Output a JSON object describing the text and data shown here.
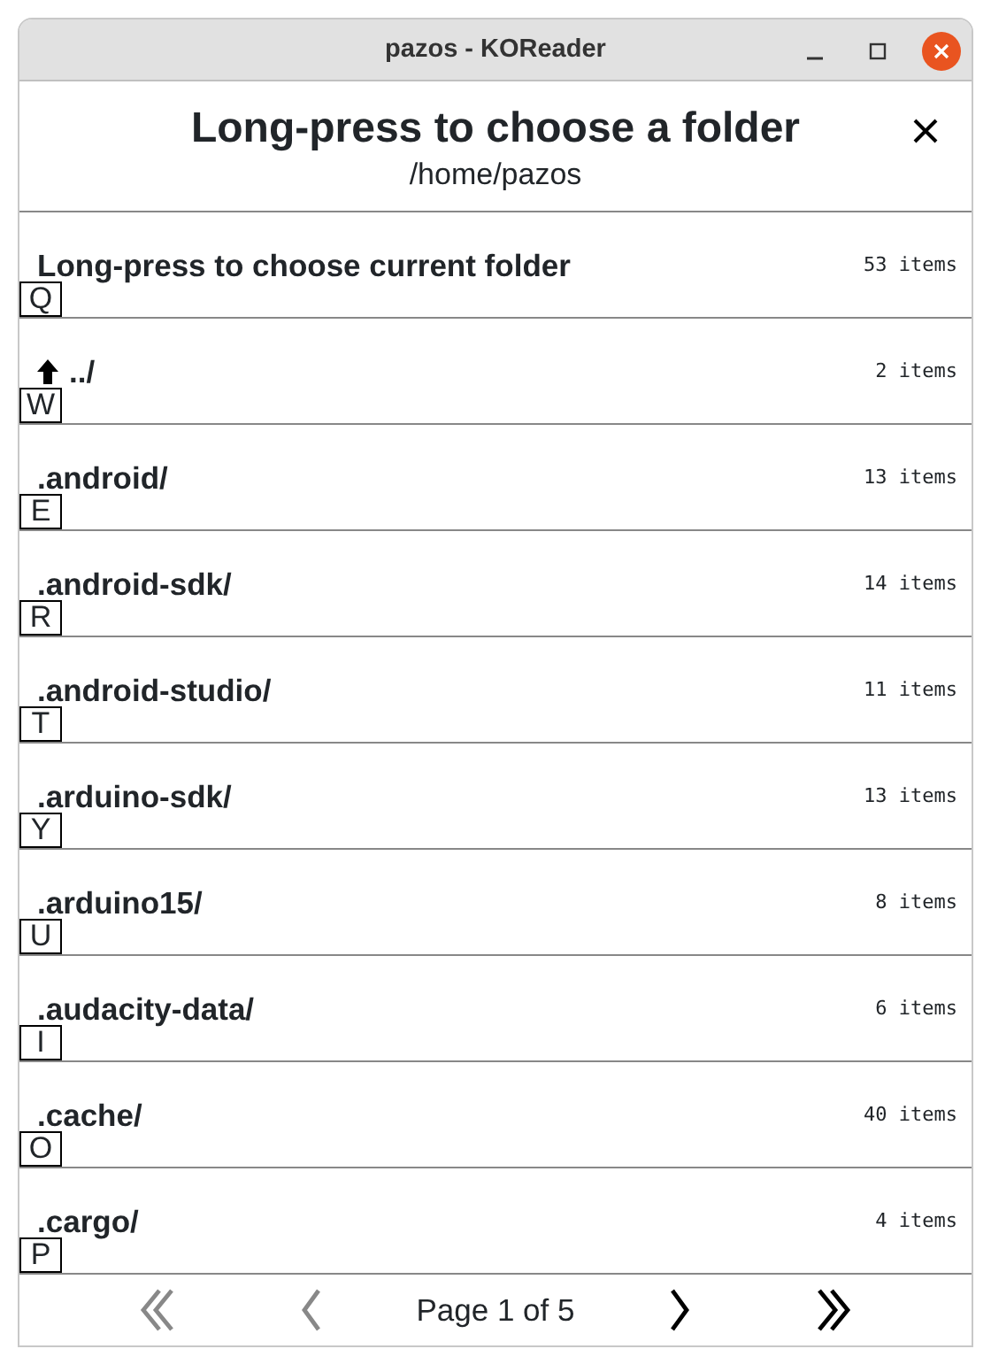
{
  "window": {
    "title": "pazos - KOReader"
  },
  "dialog": {
    "title": "Long-press to choose a folder",
    "path": "/home/pazos"
  },
  "rows": [
    {
      "kind": "current",
      "name": "Long-press to choose current folder",
      "count": "53 items",
      "key": "Q"
    },
    {
      "kind": "up",
      "name": "../",
      "count": "2 items",
      "key": "W"
    },
    {
      "kind": "folder",
      "name": ".android/",
      "count": "13 items",
      "key": "E"
    },
    {
      "kind": "folder",
      "name": ".android-sdk/",
      "count": "14 items",
      "key": "R"
    },
    {
      "kind": "folder",
      "name": ".android-studio/",
      "count": "11 items",
      "key": "T"
    },
    {
      "kind": "folder",
      "name": ".arduino-sdk/",
      "count": "13 items",
      "key": "Y"
    },
    {
      "kind": "folder",
      "name": ".arduino15/",
      "count": "8 items",
      "key": "U"
    },
    {
      "kind": "folder",
      "name": ".audacity-data/",
      "count": "6 items",
      "key": "I"
    },
    {
      "kind": "folder",
      "name": ".cache/",
      "count": "40 items",
      "key": "O"
    },
    {
      "kind": "folder",
      "name": ".cargo/",
      "count": "4 items",
      "key": "P"
    }
  ],
  "pagination": {
    "label": "Page 1 of 5",
    "first_disabled": true,
    "prev_disabled": true,
    "next_disabled": false,
    "last_disabled": false
  }
}
